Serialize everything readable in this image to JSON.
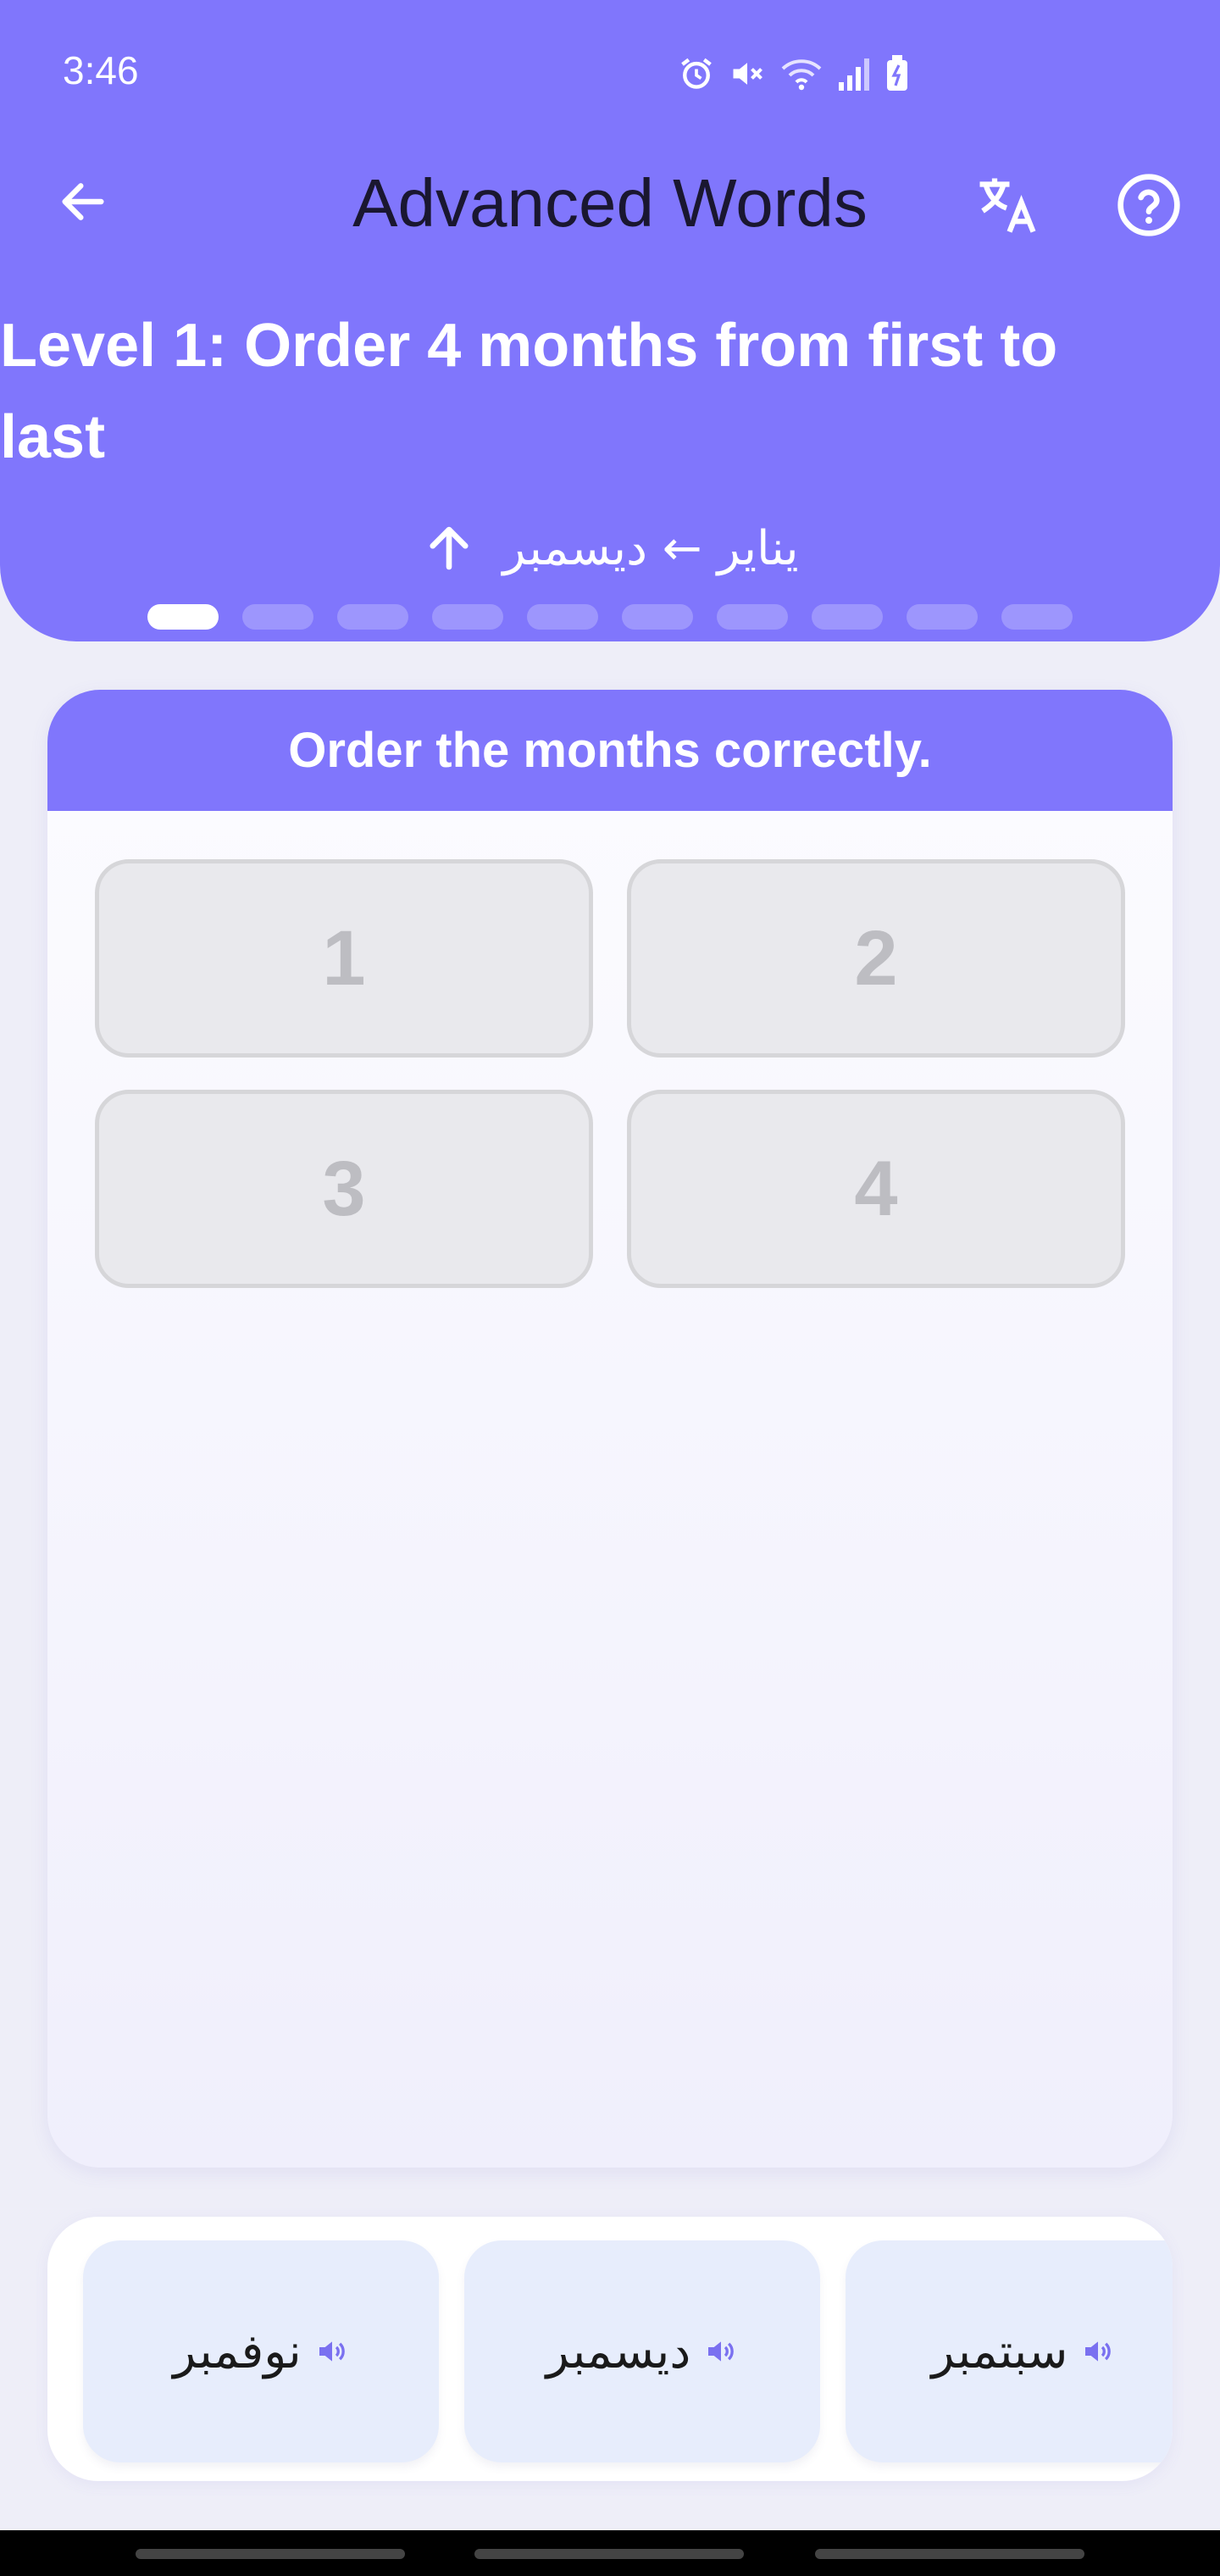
{
  "status_bar": {
    "time": "3:46"
  },
  "topbar": {
    "title": "Advanced Words",
    "back_icon": "arrow-left-icon",
    "translate_icon": "translate-icon",
    "help_icon": "help-circle-icon"
  },
  "level": {
    "title": "Level 1: Order 4 months from first to last",
    "hint": "يناير ← ديسمبر",
    "hint_icon": "arrow-up-icon",
    "progress_total": 10,
    "progress_current": 1
  },
  "card": {
    "instruction": "Order the months correctly.",
    "slots": [
      "1",
      "2",
      "3",
      "4"
    ]
  },
  "options": [
    {
      "word": "نوفمبر",
      "icon": "speaker-icon"
    },
    {
      "word": "ديسمبر",
      "icon": "speaker-icon"
    },
    {
      "word": "سبتمبر",
      "icon": "speaker-icon"
    }
  ],
  "colors": {
    "accent": "#8076fc",
    "slot_bg": "#e9e9ed",
    "option_bg": "#e7edfc"
  }
}
